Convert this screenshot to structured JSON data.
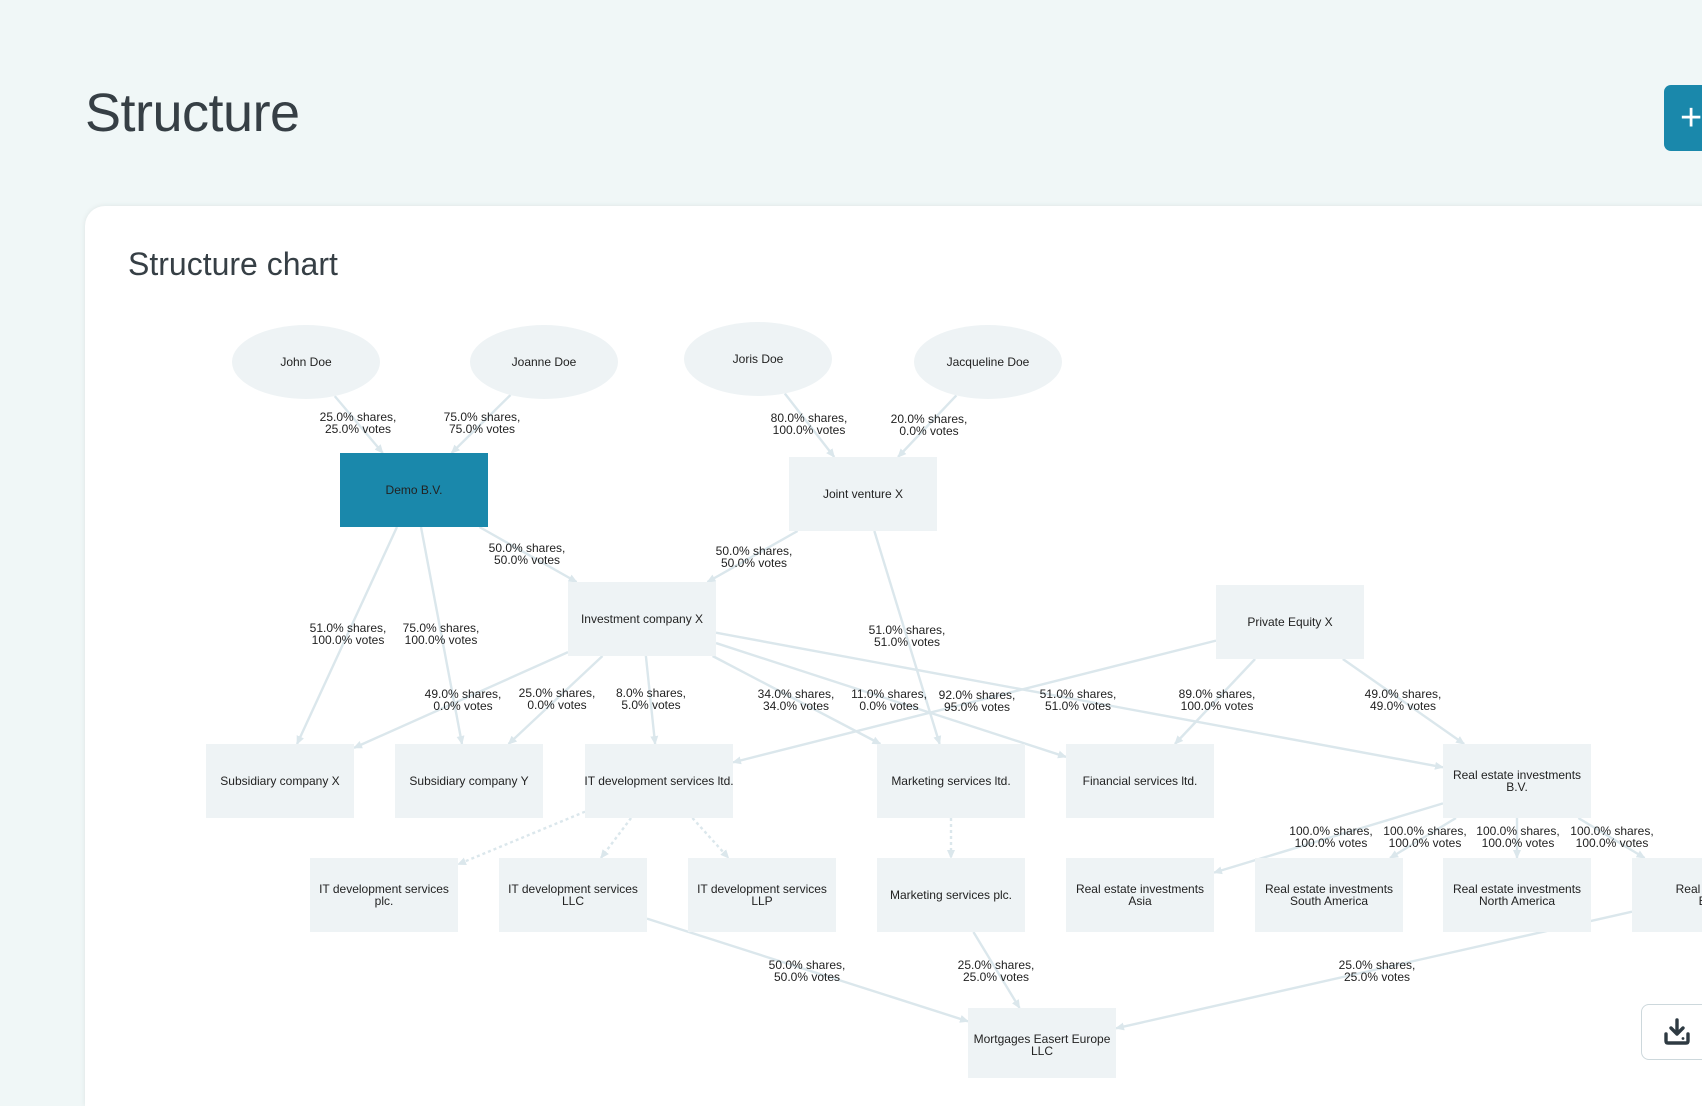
{
  "header": {
    "title": "Structure",
    "add_button_icon": "+"
  },
  "card": {
    "title": "Structure chart",
    "download_icon": "download-icon"
  },
  "colors": {
    "node_fill": "#eef3f5",
    "highlight_fill": "#1a88ab",
    "edge": "#dbe7ec",
    "text": "#222222",
    "accent": "#1a88ab"
  },
  "chart_data": {
    "type": "diagram",
    "nodes": [
      {
        "id": "john",
        "label": "John Doe",
        "shape": "ellipse"
      },
      {
        "id": "joanne",
        "label": "Joanne Doe",
        "shape": "ellipse"
      },
      {
        "id": "joris",
        "label": "Joris Doe",
        "shape": "ellipse"
      },
      {
        "id": "jacqueline",
        "label": "Jacqueline Doe",
        "shape": "ellipse"
      },
      {
        "id": "demo",
        "label": "Demo B.V.",
        "shape": "rect",
        "highlight": true
      },
      {
        "id": "jv",
        "label": "Joint venture X",
        "shape": "rect"
      },
      {
        "id": "inv",
        "label": "Investment company X",
        "shape": "rect"
      },
      {
        "id": "pe",
        "label": "Private Equity X",
        "shape": "rect"
      },
      {
        "id": "subx",
        "label": "Subsidiary company X",
        "shape": "rect"
      },
      {
        "id": "suby",
        "label": "Subsidiary company Y",
        "shape": "rect"
      },
      {
        "id": "itltd",
        "label": "IT development services ltd.",
        "shape": "rect"
      },
      {
        "id": "mktltd",
        "label": "Marketing services ltd.",
        "shape": "rect"
      },
      {
        "id": "finltd",
        "label": "Financial services ltd.",
        "shape": "rect"
      },
      {
        "id": "rebv",
        "label": [
          "Real estate investments",
          "B.V."
        ],
        "shape": "rect"
      },
      {
        "id": "itplc",
        "label": [
          "IT development services",
          "plc."
        ],
        "shape": "rect"
      },
      {
        "id": "itllc",
        "label": [
          "IT development services",
          "LLC"
        ],
        "shape": "rect"
      },
      {
        "id": "itllp",
        "label": [
          "IT development services",
          "LLP"
        ],
        "shape": "rect"
      },
      {
        "id": "mktplc",
        "label": "Marketing services plc.",
        "shape": "rect"
      },
      {
        "id": "reasia",
        "label": [
          "Real estate investments",
          "Asia"
        ],
        "shape": "rect"
      },
      {
        "id": "resa",
        "label": [
          "Real estate investments",
          "South America"
        ],
        "shape": "rect"
      },
      {
        "id": "rena",
        "label": [
          "Real estate investments",
          "North America"
        ],
        "shape": "rect"
      },
      {
        "id": "reeu",
        "label": [
          "Real estate",
          "Eu"
        ],
        "shape": "rect"
      },
      {
        "id": "mortg",
        "label": [
          "Mortgages Easert Europe",
          "LLC"
        ],
        "shape": "rect"
      }
    ],
    "edges": [
      {
        "from": "john",
        "to": "demo",
        "label": [
          "25.0% shares,",
          "25.0% votes"
        ]
      },
      {
        "from": "joanne",
        "to": "demo",
        "label": [
          "75.0% shares,",
          "75.0% votes"
        ]
      },
      {
        "from": "joris",
        "to": "jv",
        "label": [
          "80.0% shares,",
          "100.0% votes"
        ]
      },
      {
        "from": "jacqueline",
        "to": "jv",
        "label": [
          "20.0% shares,",
          "0.0% votes"
        ]
      },
      {
        "from": "demo",
        "to": "inv",
        "label": [
          "50.0% shares,",
          "50.0% votes"
        ]
      },
      {
        "from": "jv",
        "to": "inv",
        "label": [
          "50.0% shares,",
          "50.0% votes"
        ]
      },
      {
        "from": "demo",
        "to": "subx",
        "label": [
          "51.0% shares,",
          "100.0% votes"
        ]
      },
      {
        "from": "demo",
        "to": "suby",
        "label": [
          "75.0% shares,",
          "100.0% votes"
        ]
      },
      {
        "from": "jv",
        "to": "mktltd",
        "label": [
          "51.0% shares,",
          "51.0% votes"
        ]
      },
      {
        "from": "inv",
        "to": "subx",
        "label": [
          "49.0% shares,",
          "0.0% votes"
        ]
      },
      {
        "from": "inv",
        "to": "suby",
        "label": [
          "25.0% shares,",
          "0.0% votes"
        ]
      },
      {
        "from": "inv",
        "to": "itltd",
        "label": [
          "8.0% shares,",
          "5.0% votes"
        ]
      },
      {
        "from": "inv",
        "to": "mktltd",
        "label": [
          "34.0% shares,",
          "34.0% votes"
        ]
      },
      {
        "from": "inv",
        "to": "finltd",
        "label": [
          "11.0% shares,",
          "0.0% votes"
        ]
      },
      {
        "from": "inv",
        "to": "rebv",
        "label": [
          "51.0% shares,",
          "51.0% votes"
        ]
      },
      {
        "from": "pe",
        "to": "itltd",
        "label": [
          "92.0% shares,",
          "95.0% votes"
        ]
      },
      {
        "from": "pe",
        "to": "finltd",
        "label": [
          "89.0% shares,",
          "100.0% votes"
        ]
      },
      {
        "from": "pe",
        "to": "rebv",
        "label": [
          "49.0% shares,",
          "49.0% votes"
        ]
      },
      {
        "from": "itltd",
        "to": "itplc",
        "dashed": true
      },
      {
        "from": "itltd",
        "to": "itllc",
        "dashed": true
      },
      {
        "from": "itltd",
        "to": "itllp",
        "dashed": true
      },
      {
        "from": "mktltd",
        "to": "mktplc",
        "dashed": true
      },
      {
        "from": "rebv",
        "to": "reasia",
        "label": [
          "100.0% shares,",
          "100.0% votes"
        ]
      },
      {
        "from": "rebv",
        "to": "resa",
        "label": [
          "100.0% shares,",
          "100.0% votes"
        ]
      },
      {
        "from": "rebv",
        "to": "rena",
        "label": [
          "100.0% shares,",
          "100.0% votes"
        ]
      },
      {
        "from": "rebv",
        "to": "reeu",
        "label": [
          "100.0% shares,",
          "100.0% votes"
        ]
      },
      {
        "from": "itllc",
        "to": "mortg",
        "label": [
          "50.0% shares,",
          "50.0% votes"
        ]
      },
      {
        "from": "mktplc",
        "to": "mortg",
        "label": [
          "25.0% shares,",
          "25.0% votes"
        ]
      },
      {
        "from": "reeu",
        "to": "mortg",
        "label": [
          "25.0% shares,",
          "25.0% votes"
        ]
      }
    ]
  }
}
